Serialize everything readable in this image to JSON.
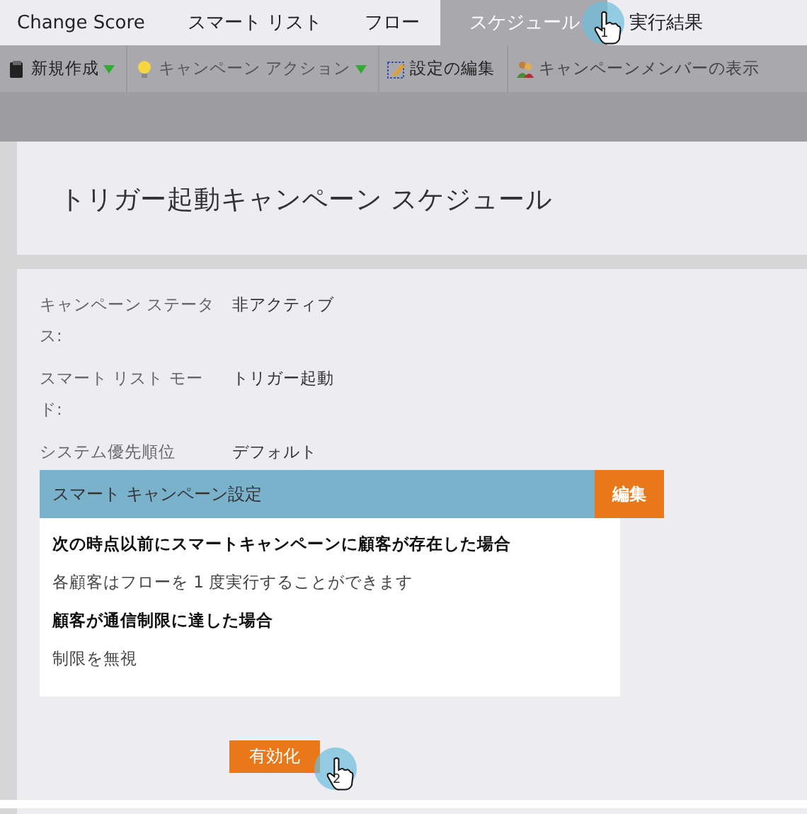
{
  "tabs": [
    {
      "label": "Change Score",
      "selected": false
    },
    {
      "label": "スマート リスト",
      "selected": false
    },
    {
      "label": "フロー",
      "selected": false
    },
    {
      "label": "スケジュール",
      "selected": true
    },
    {
      "label": "実行結果",
      "selected": false
    }
  ],
  "toolbar": [
    {
      "kind": "new",
      "label": "新規作成",
      "has_menu": true
    },
    {
      "kind": "actions",
      "label": "キャンペーン アクション",
      "has_menu": true
    },
    {
      "kind": "edit",
      "label": "設定の編集",
      "has_menu": false
    },
    {
      "kind": "members",
      "label": "キャンペーンメンバーの表示",
      "has_menu": false
    }
  ],
  "page_title": "トリガー起動キャンペーン スケジュール",
  "fields": [
    {
      "label": "キャンペーン ステータス:",
      "value": "非アクティブ"
    },
    {
      "label": "スマート リスト モード:",
      "value": "トリガー起動"
    },
    {
      "label": "システム優先順位",
      "value": "デフォルト"
    }
  ],
  "settings_panel": {
    "title": "スマート キャンペーン設定",
    "edit_button": "編集",
    "lines": [
      {
        "kind": "heading",
        "text": "次の時点以前にスマートキャンペーンに顧客が存在した場合"
      },
      {
        "kind": "text",
        "text": "各顧客はフローを 1 度実行することができます"
      },
      {
        "kind": "heading",
        "text": "顧客が通信制限に達した場合"
      },
      {
        "kind": "text",
        "text": "制限を無視"
      }
    ]
  },
  "activate_button": "有効化",
  "step_markers": [
    {
      "number": "1"
    },
    {
      "number": "2"
    }
  ]
}
